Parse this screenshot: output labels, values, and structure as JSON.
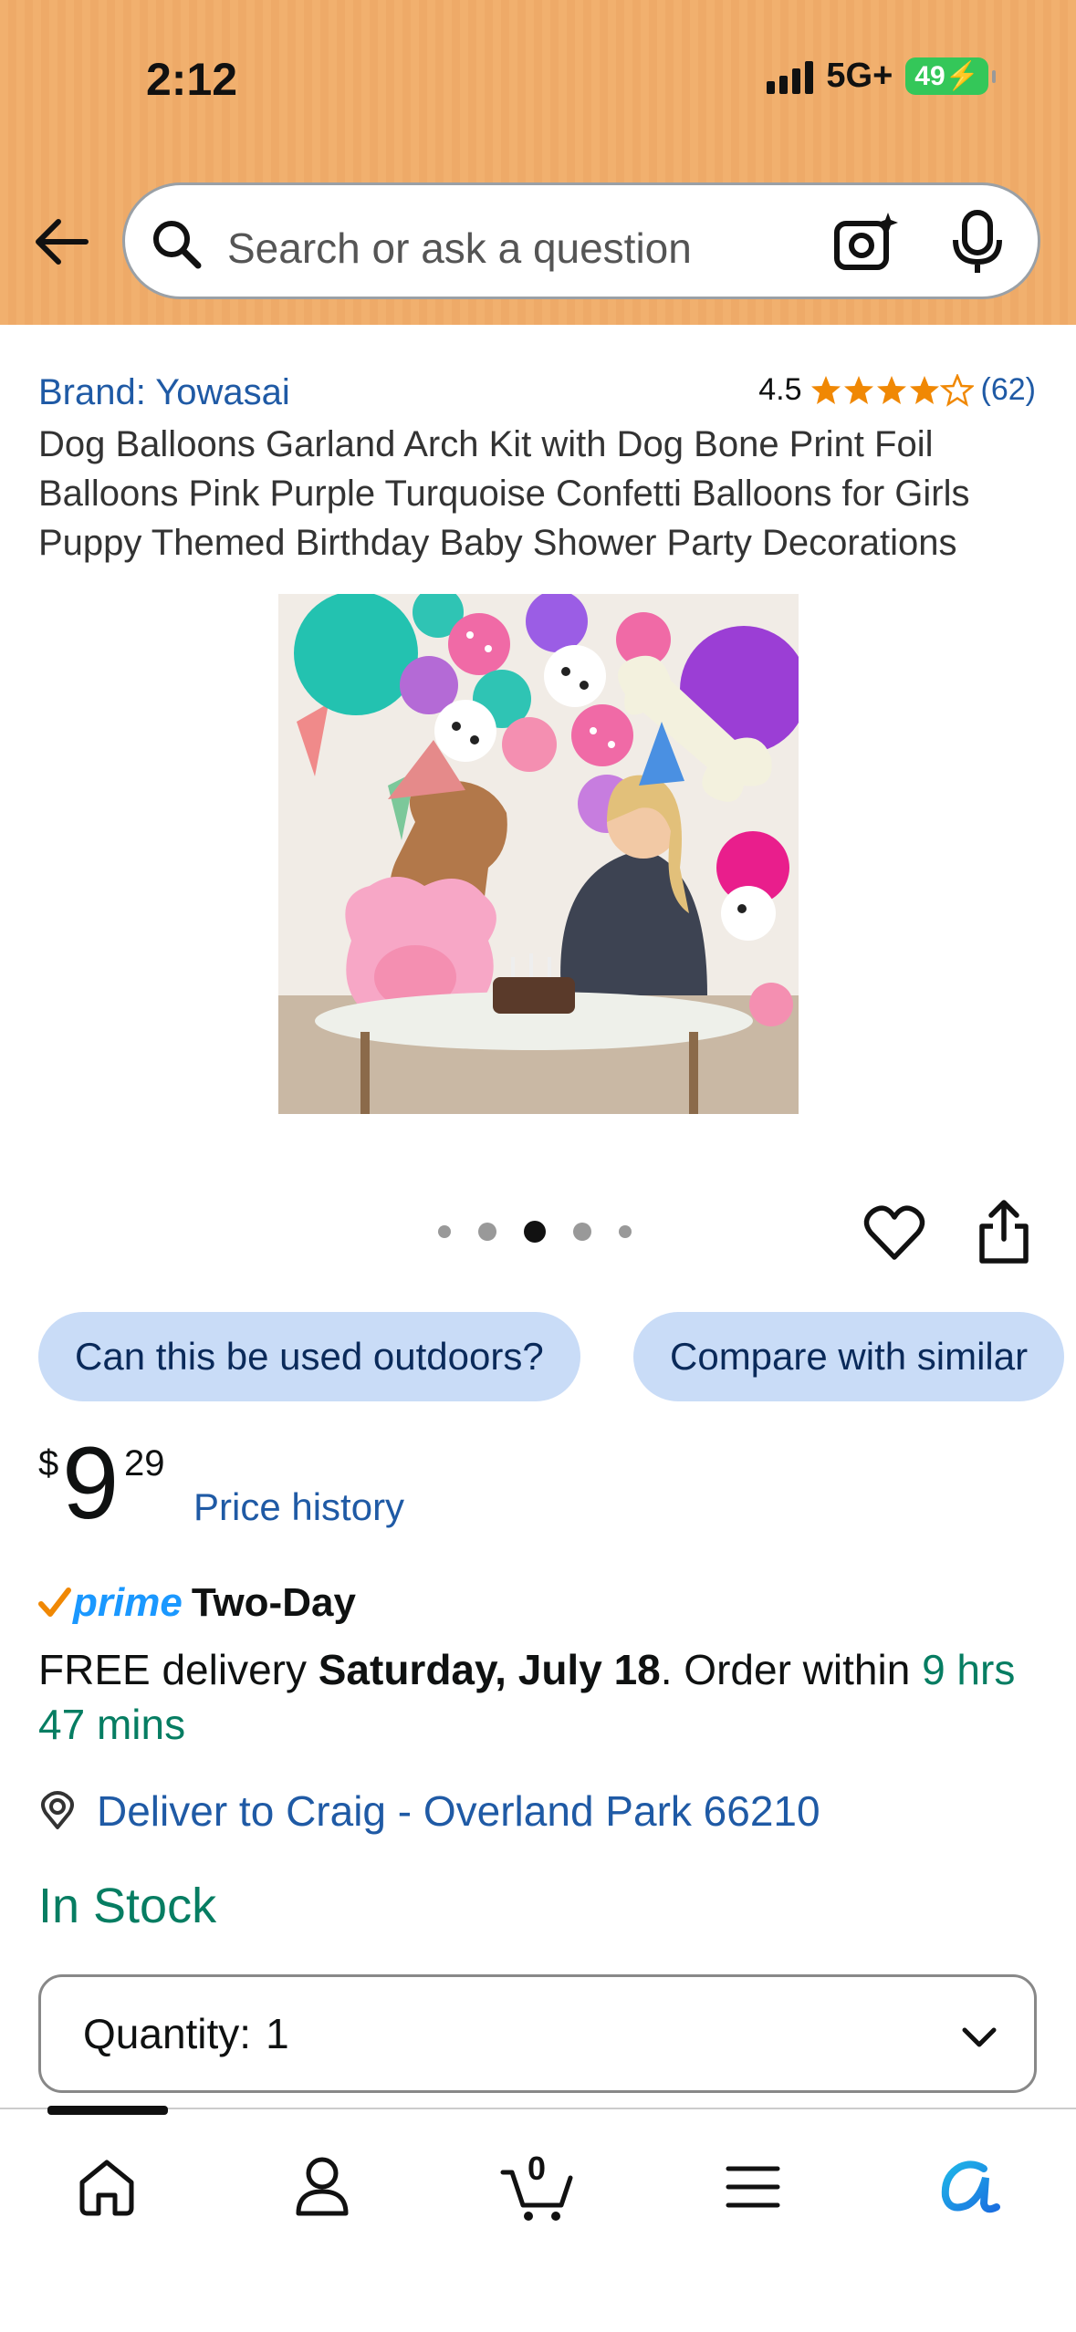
{
  "status_bar": {
    "time": "2:12",
    "network": "5G+",
    "battery": "49"
  },
  "search": {
    "placeholder": "Search or ask a question"
  },
  "product": {
    "brand": "Brand: Yowasai",
    "rating": "4.5",
    "rating_count": "(62)",
    "title": "Dog Balloons Garland Arch Kit with Dog Bone Print Foil Balloons Pink Purple Turquoise Confetti Balloons for Girls Puppy Themed Birthday Baby Shower Party Decorations",
    "image_count": 5,
    "active_image_index": 3
  },
  "chips": [
    "Can this be used outdoors?",
    "Compare with similar"
  ],
  "price": {
    "symbol": "$",
    "whole": "9",
    "fraction": "29",
    "history_link": "Price history"
  },
  "delivery": {
    "prime_label": "prime",
    "speed": "Two-Day",
    "prefix": "FREE delivery ",
    "date": "Saturday, July 18",
    "order_within": ". Order within ",
    "countdown": "9 hrs 47 mins"
  },
  "location": {
    "text": "Deliver to Craig - Overland Park 66210"
  },
  "stock": "In Stock",
  "quantity": {
    "label": "Quantity:",
    "value": "1"
  },
  "cart_count": "0",
  "colors": {
    "header": "#f1b06e",
    "link": "#1f5aa5",
    "stock_green": "#067d62",
    "chip": "#c9dcf7",
    "star": "#f08804",
    "prime_blue": "#1a98ff"
  },
  "nav": [
    "home-icon",
    "account-icon",
    "cart-icon",
    "menu-icon",
    "rufus-icon"
  ]
}
